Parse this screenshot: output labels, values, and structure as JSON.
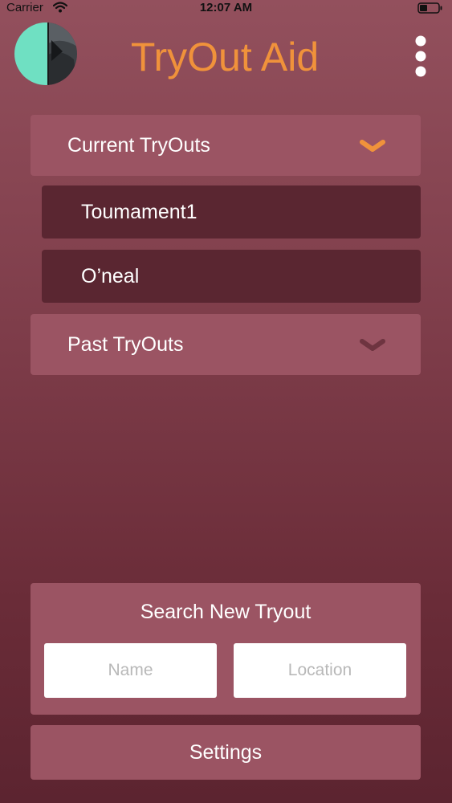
{
  "status_bar": {
    "carrier": "Carrier",
    "time": "12:07 AM",
    "wifi_icon": "wifi-icon",
    "battery_icon": "battery-icon"
  },
  "header": {
    "title": "TryOut Aid",
    "avatar_icon": "avatar-image",
    "menu_icon": "vertical-ellipsis-icon"
  },
  "sections": {
    "current": {
      "label": "Current TryOuts",
      "expanded": true,
      "chevron_color": "#f0923b",
      "items": [
        {
          "label": "Toumament1"
        },
        {
          "label": "O’neal"
        }
      ]
    },
    "past": {
      "label": "Past TryOuts",
      "expanded": false,
      "chevron_color": "#6e3440"
    }
  },
  "search": {
    "title": "Search New Tryout",
    "name_placeholder": "Name",
    "location_placeholder": "Location"
  },
  "settings": {
    "label": "Settings"
  },
  "colors": {
    "accent": "#f0923b",
    "panel": "#9b5463",
    "item": "#5a2631",
    "background_top": "#93505d",
    "background_bottom": "#5c2430"
  }
}
